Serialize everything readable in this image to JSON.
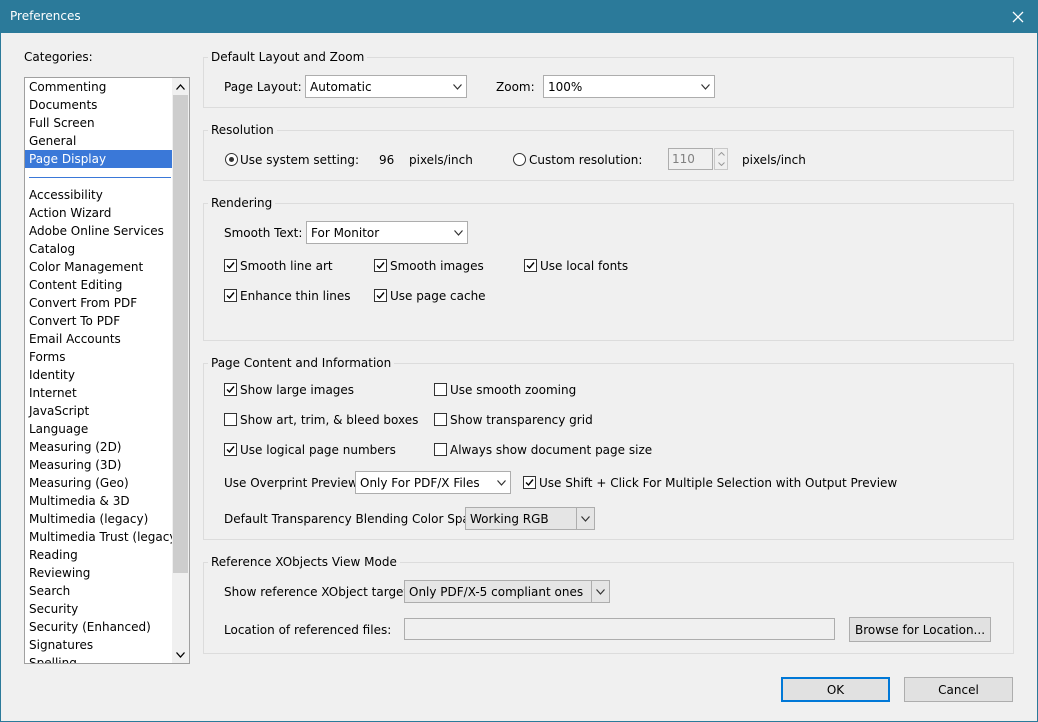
{
  "window": {
    "title": "Preferences"
  },
  "categories": {
    "label": "Categories:",
    "top_items": [
      "Commenting",
      "Documents",
      "Full Screen",
      "General",
      "Page Display"
    ],
    "selected": "Page Display",
    "items": [
      "Accessibility",
      "Action Wizard",
      "Adobe Online Services",
      "Catalog",
      "Color Management",
      "Content Editing",
      "Convert From PDF",
      "Convert To PDF",
      "Email Accounts",
      "Forms",
      "Identity",
      "Internet",
      "JavaScript",
      "Language",
      "Measuring (2D)",
      "Measuring (3D)",
      "Measuring (Geo)",
      "Multimedia & 3D",
      "Multimedia (legacy)",
      "Multimedia Trust (legacy)",
      "Reading",
      "Reviewing",
      "Search",
      "Security",
      "Security (Enhanced)",
      "Signatures",
      "Spelling"
    ]
  },
  "layout_zoom": {
    "title": "Default Layout and Zoom",
    "page_layout_label": "Page Layout:",
    "page_layout_value": "Automatic",
    "zoom_label": "Zoom:",
    "zoom_value": "100%"
  },
  "resolution": {
    "title": "Resolution",
    "system_label": "Use system setting:",
    "system_value": "96",
    "system_unit": "pixels/inch",
    "custom_label": "Custom resolution:",
    "custom_value": "110",
    "custom_unit": "pixels/inch"
  },
  "rendering": {
    "title": "Rendering",
    "smooth_text_label": "Smooth Text:",
    "smooth_text_value": "For Monitor",
    "smooth_line_art": "Smooth line art",
    "smooth_images": "Smooth images",
    "use_local_fonts": "Use local fonts",
    "enhance_thin_lines": "Enhance thin lines",
    "use_page_cache": "Use page cache"
  },
  "page_content": {
    "title": "Page Content and Information",
    "show_large_images": "Show large images",
    "use_smooth_zooming": "Use smooth zooming",
    "show_art_trim": "Show art, trim, & bleed boxes",
    "show_transparency_grid": "Show transparency grid",
    "use_logical_page_numbers": "Use logical page numbers",
    "always_show_page_size": "Always show document page size",
    "overprint_label": "Use Overprint Preview:",
    "overprint_value": "Only For PDF/X Files",
    "shift_click": "Use Shift + Click For Multiple Selection with Output Preview",
    "blending_label": "Default Transparency Blending Color Space:",
    "blending_value": "Working RGB"
  },
  "xobjects": {
    "title": "Reference XObjects View Mode",
    "targets_label": "Show reference XObject targets:",
    "targets_value": "Only PDF/X-5 compliant ones",
    "location_label": "Location of referenced files:",
    "location_value": "",
    "browse_label": "Browse for Location..."
  },
  "footer": {
    "ok_label": "OK",
    "cancel_label": "Cancel"
  }
}
